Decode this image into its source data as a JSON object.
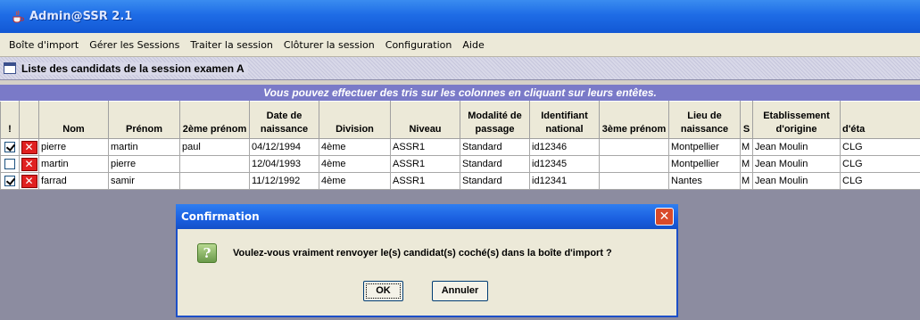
{
  "window": {
    "title": "Admin@SSR 2.1"
  },
  "menu": [
    "Boîte d'import",
    "Gérer les Sessions",
    "Traiter la session",
    "Clôturer la session",
    "Configuration",
    "Aide"
  ],
  "panel": {
    "title": "Liste des candidats de la session  examen A"
  },
  "banner": "Vous pouvez effectuer des tris sur les colonnes en cliquant sur leurs entêtes.",
  "table": {
    "headers": [
      "!",
      "",
      "Nom",
      "Prénom",
      "2ème prénom",
      "Date de naissance",
      "Division",
      "Niveau",
      "Modalité de passage",
      "Identifiant national",
      "3ème prénom",
      "Lieu de naissance",
      "S",
      "Etablissement d'origine",
      "d'éta"
    ],
    "rows": [
      {
        "checked": true,
        "nom": "pierre",
        "prenom": "martin",
        "prenom2": "paul",
        "date": "04/12/1994",
        "division": "4ème",
        "niveau": "ASSR1",
        "modalite": "Standard",
        "identifiant": "id12346",
        "prenom3": "",
        "lieu": "Montpellier",
        "sexe": "M",
        "etablissement": "Jean Moulin",
        "etat": "CLG"
      },
      {
        "checked": false,
        "nom": "martin",
        "prenom": "pierre",
        "prenom2": "",
        "date": "12/04/1993",
        "division": "4ème",
        "niveau": "ASSR1",
        "modalite": "Standard",
        "identifiant": "id12345",
        "prenom3": "",
        "lieu": "Montpellier",
        "sexe": "M",
        "etablissement": "Jean Moulin",
        "etat": "CLG"
      },
      {
        "checked": true,
        "nom": "farrad",
        "prenom": "samir",
        "prenom2": "",
        "date": "11/12/1992",
        "division": "4ème",
        "niveau": "ASSR1",
        "modalite": "Standard",
        "identifiant": "id12341",
        "prenom3": "",
        "lieu": "Nantes",
        "sexe": "M",
        "etablissement": "Jean Moulin",
        "etat": "CLG"
      }
    ],
    "delete_symbol": "✕"
  },
  "dialog": {
    "title": "Confirmation",
    "message": "Voulez-vous vraiment renvoyer le(s) candidat(s) coché(s) dans la boîte d'import ?",
    "ok_label": "OK",
    "cancel_label": "Annuler",
    "close_symbol": "✕",
    "question_symbol": "?"
  },
  "colors": {
    "titlebar": "#1e6ce6",
    "banner": "#7a7ac8",
    "gray_area": "#8c8ca0",
    "delete": "#e02020"
  }
}
